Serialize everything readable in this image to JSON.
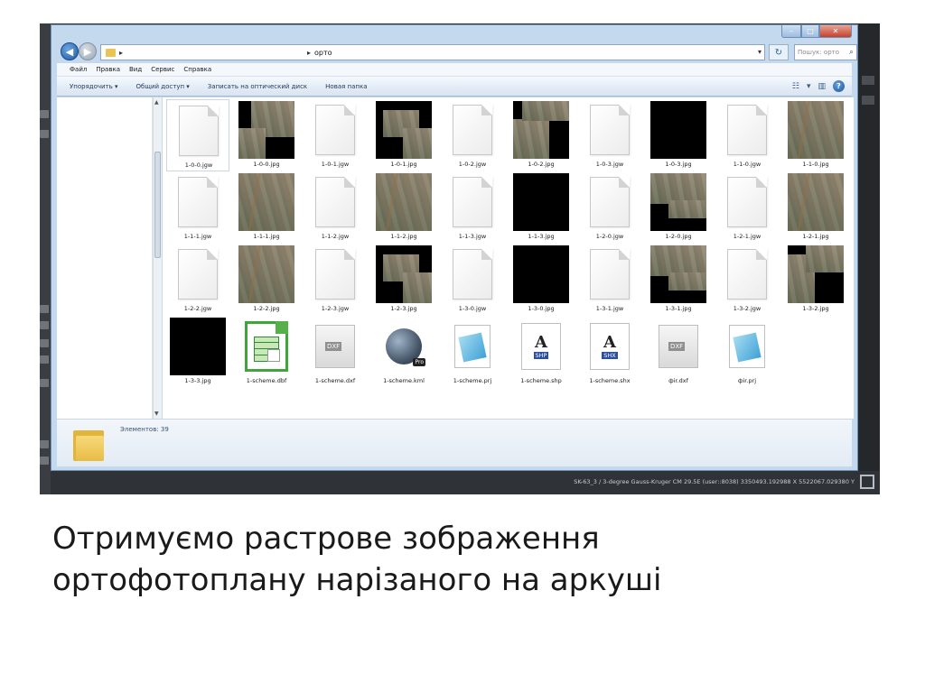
{
  "window": {
    "address": {
      "current_folder": "орто"
    },
    "search": {
      "placeholder": "Пошук: орто"
    },
    "menu": [
      "Файл",
      "Правка",
      "Вид",
      "Сервис",
      "Справка"
    ],
    "toolbar": {
      "organize": "Упорядочить ▾",
      "share": "Общий доступ ▾",
      "burn": "Записать на оптический диск",
      "new_folder": "Новая папка"
    },
    "files": [
      {
        "name": "1-0-0.jgw",
        "kind": "doc"
      },
      {
        "name": "1-0-0.jpg",
        "kind": "mixed"
      },
      {
        "name": "1-0-1.jgw",
        "kind": "doc"
      },
      {
        "name": "1-0-1.jpg",
        "kind": "mixed"
      },
      {
        "name": "1-0-2.jgw",
        "kind": "doc"
      },
      {
        "name": "1-0-2.jpg",
        "kind": "mixed"
      },
      {
        "name": "1-0-3.jgw",
        "kind": "doc"
      },
      {
        "name": "1-0-3.jpg",
        "kind": "black"
      },
      {
        "name": "1-1-0.jgw",
        "kind": "doc"
      },
      {
        "name": "1-1-0.jpg",
        "kind": "aerial"
      },
      {
        "name": "1-1-1.jgw",
        "kind": "doc"
      },
      {
        "name": "1-1-1.jpg",
        "kind": "aerial"
      },
      {
        "name": "1-1-2.jgw",
        "kind": "doc"
      },
      {
        "name": "1-1-2.jpg",
        "kind": "aerial"
      },
      {
        "name": "1-1-3.jgw",
        "kind": "doc"
      },
      {
        "name": "1-1-3.jpg",
        "kind": "black"
      },
      {
        "name": "1-2-0.jgw",
        "kind": "doc"
      },
      {
        "name": "1-2-0.jpg",
        "kind": "mixed"
      },
      {
        "name": "1-2-1.jgw",
        "kind": "doc"
      },
      {
        "name": "1-2-1.jpg",
        "kind": "aerial"
      },
      {
        "name": "1-2-2.jgw",
        "kind": "doc"
      },
      {
        "name": "1-2-2.jpg",
        "kind": "aerial"
      },
      {
        "name": "1-2-3.jgw",
        "kind": "doc"
      },
      {
        "name": "1-2-3.jpg",
        "kind": "mixed"
      },
      {
        "name": "1-3-0.jgw",
        "kind": "doc"
      },
      {
        "name": "1-3-0.jpg",
        "kind": "black"
      },
      {
        "name": "1-3-1.jgw",
        "kind": "doc"
      },
      {
        "name": "1-3-1.jpg",
        "kind": "mixed"
      },
      {
        "name": "1-3-2.jgw",
        "kind": "doc"
      },
      {
        "name": "1-3-2.jpg",
        "kind": "mixed"
      },
      {
        "name": "1-3-3.jpg",
        "kind": "black"
      },
      {
        "name": "1-scheme.dbf",
        "kind": "dbf"
      },
      {
        "name": "1-scheme.dxf",
        "kind": "dxf"
      },
      {
        "name": "1-scheme.kml",
        "kind": "kml"
      },
      {
        "name": "1-scheme.prj",
        "kind": "notepad"
      },
      {
        "name": "1-scheme.shp",
        "kind": "shp"
      },
      {
        "name": "1-scheme.shx",
        "kind": "shx"
      },
      {
        "name": "фir.dxf",
        "kind": "dxf"
      },
      {
        "name": "фir.prj",
        "kind": "notepad"
      }
    ],
    "details": {
      "count": "Элементов: 39"
    }
  },
  "icon_labels": {
    "dxf": "DXF",
    "kml": "Pro",
    "shp": "SHP",
    "shx": "SHX",
    "shp_letter": "A"
  },
  "status_bar": "SK-63_3 / 3-degree Gauss-Kruger CM 29.5E (user::8038)  3350493.192988 X  5522067.029380 Y",
  "caption": {
    "line1": "Отримуємо растрове зображення",
    "line2": "ортофотоплану нарізаного на аркуші"
  }
}
